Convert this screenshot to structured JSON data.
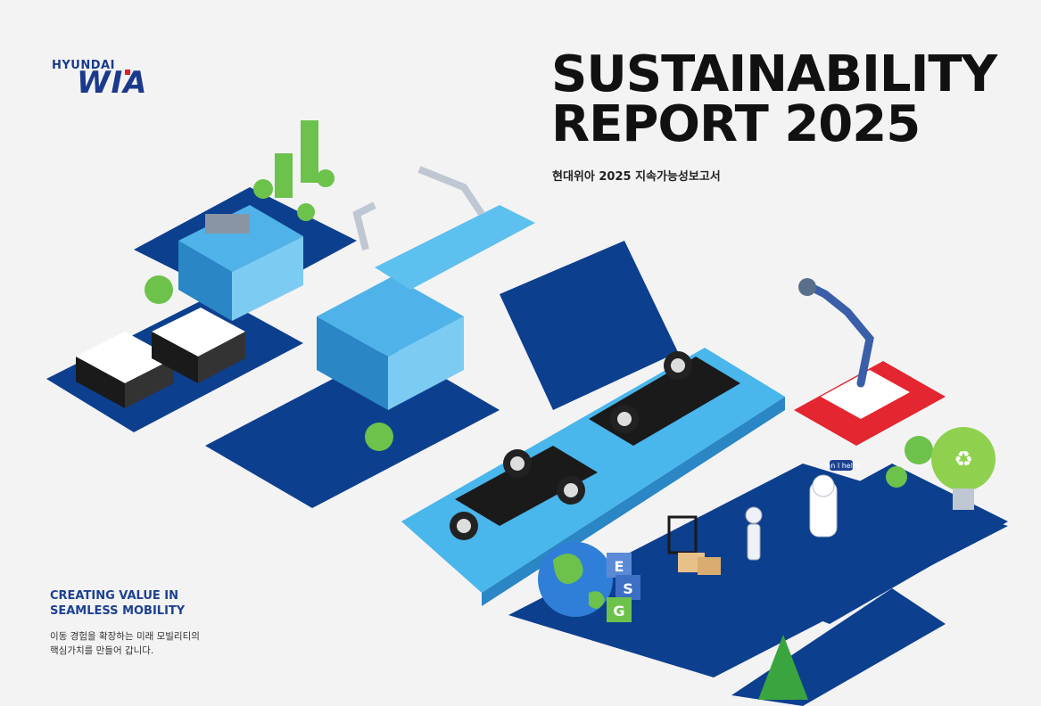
{
  "brand": {
    "logo_top": "HYUNDAI",
    "logo_main": "WIA",
    "accent_red": "#e21e26",
    "brand_blue": "#1b3a8c"
  },
  "cover": {
    "title_line1": "SUSTAINABILITY",
    "title_line2": "REPORT 2025",
    "subtitle_kr": "현대위아 2025 지속가능성보고서"
  },
  "slogan": {
    "line1": "CREATING VALUE IN",
    "line2": "SEAMLESS MOBILITY",
    "desc_line1": "이동 경험을 확장하는 미래 모빌리티의",
    "desc_line2": "핵심가치를 만들어 갑니다."
  },
  "illustration": {
    "esg_letters": [
      "E",
      "S",
      "G"
    ],
    "robot_bubble": "Can I help?",
    "colors": {
      "path_blue": "#0d3f8f",
      "machine_cyan": "#4fb3ea",
      "rover_red": "#e3262f",
      "tree_green": "#6cc24a"
    }
  }
}
